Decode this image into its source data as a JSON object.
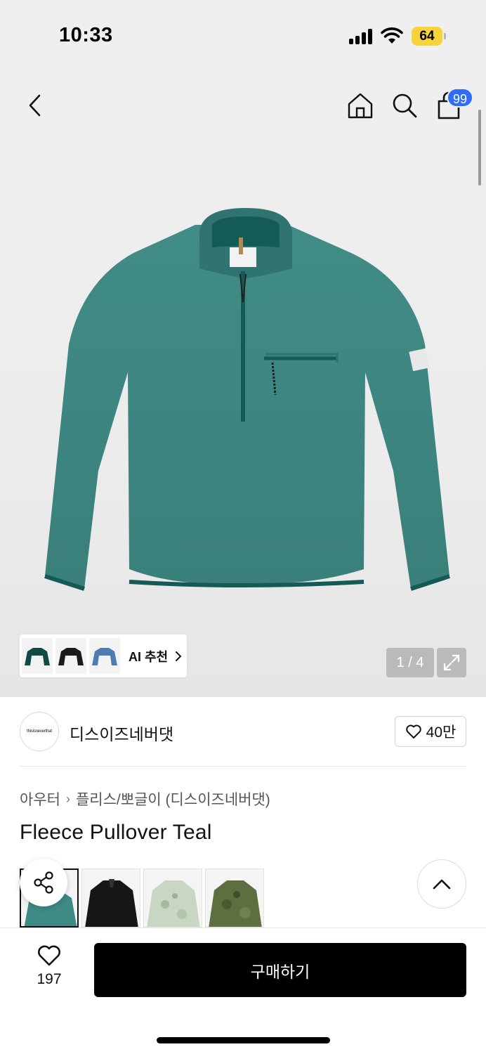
{
  "status_bar": {
    "time": "10:33",
    "battery": "64",
    "battery_color": "#f6d23b"
  },
  "header": {
    "back_icon": "chevron-left-icon",
    "home_icon": "home-icon",
    "search_icon": "search-icon",
    "cart_icon": "shopping-bag-icon",
    "cart_badge": "99",
    "badge_color": "#2f6df6"
  },
  "gallery": {
    "current_page": "1 / 4",
    "expand_icon": "expand-icon",
    "product_color": "#3f8a85",
    "ai_recommend": {
      "label": "AI 추천",
      "thumb_colors": [
        "#0f4a45",
        "#1a1a1a",
        "#4f7bb3"
      ]
    }
  },
  "brand": {
    "logo_text": "thisisneverthat",
    "name": "디스이즈네버댓",
    "likes": "40만",
    "like_icon": "heart-outline-icon"
  },
  "breadcrumb": {
    "category": "아우터",
    "subcategory": "플리스/뽀글이 (디스이즈네버댓)"
  },
  "product": {
    "title": "Fleece Pullover Teal"
  },
  "variants": [
    {
      "color": "#3f8a85",
      "selected": true
    },
    {
      "color": "#161616",
      "selected": false
    },
    {
      "color": "#c9d6c2",
      "selected": false
    },
    {
      "color": "#5d6f3e",
      "selected": false
    }
  ],
  "floating": {
    "share_icon": "share-icon",
    "top_icon": "chevron-up-icon"
  },
  "bottom_bar": {
    "wish_icon": "heart-outline-icon",
    "wish_count": "197",
    "buy_label": "구매하기"
  }
}
